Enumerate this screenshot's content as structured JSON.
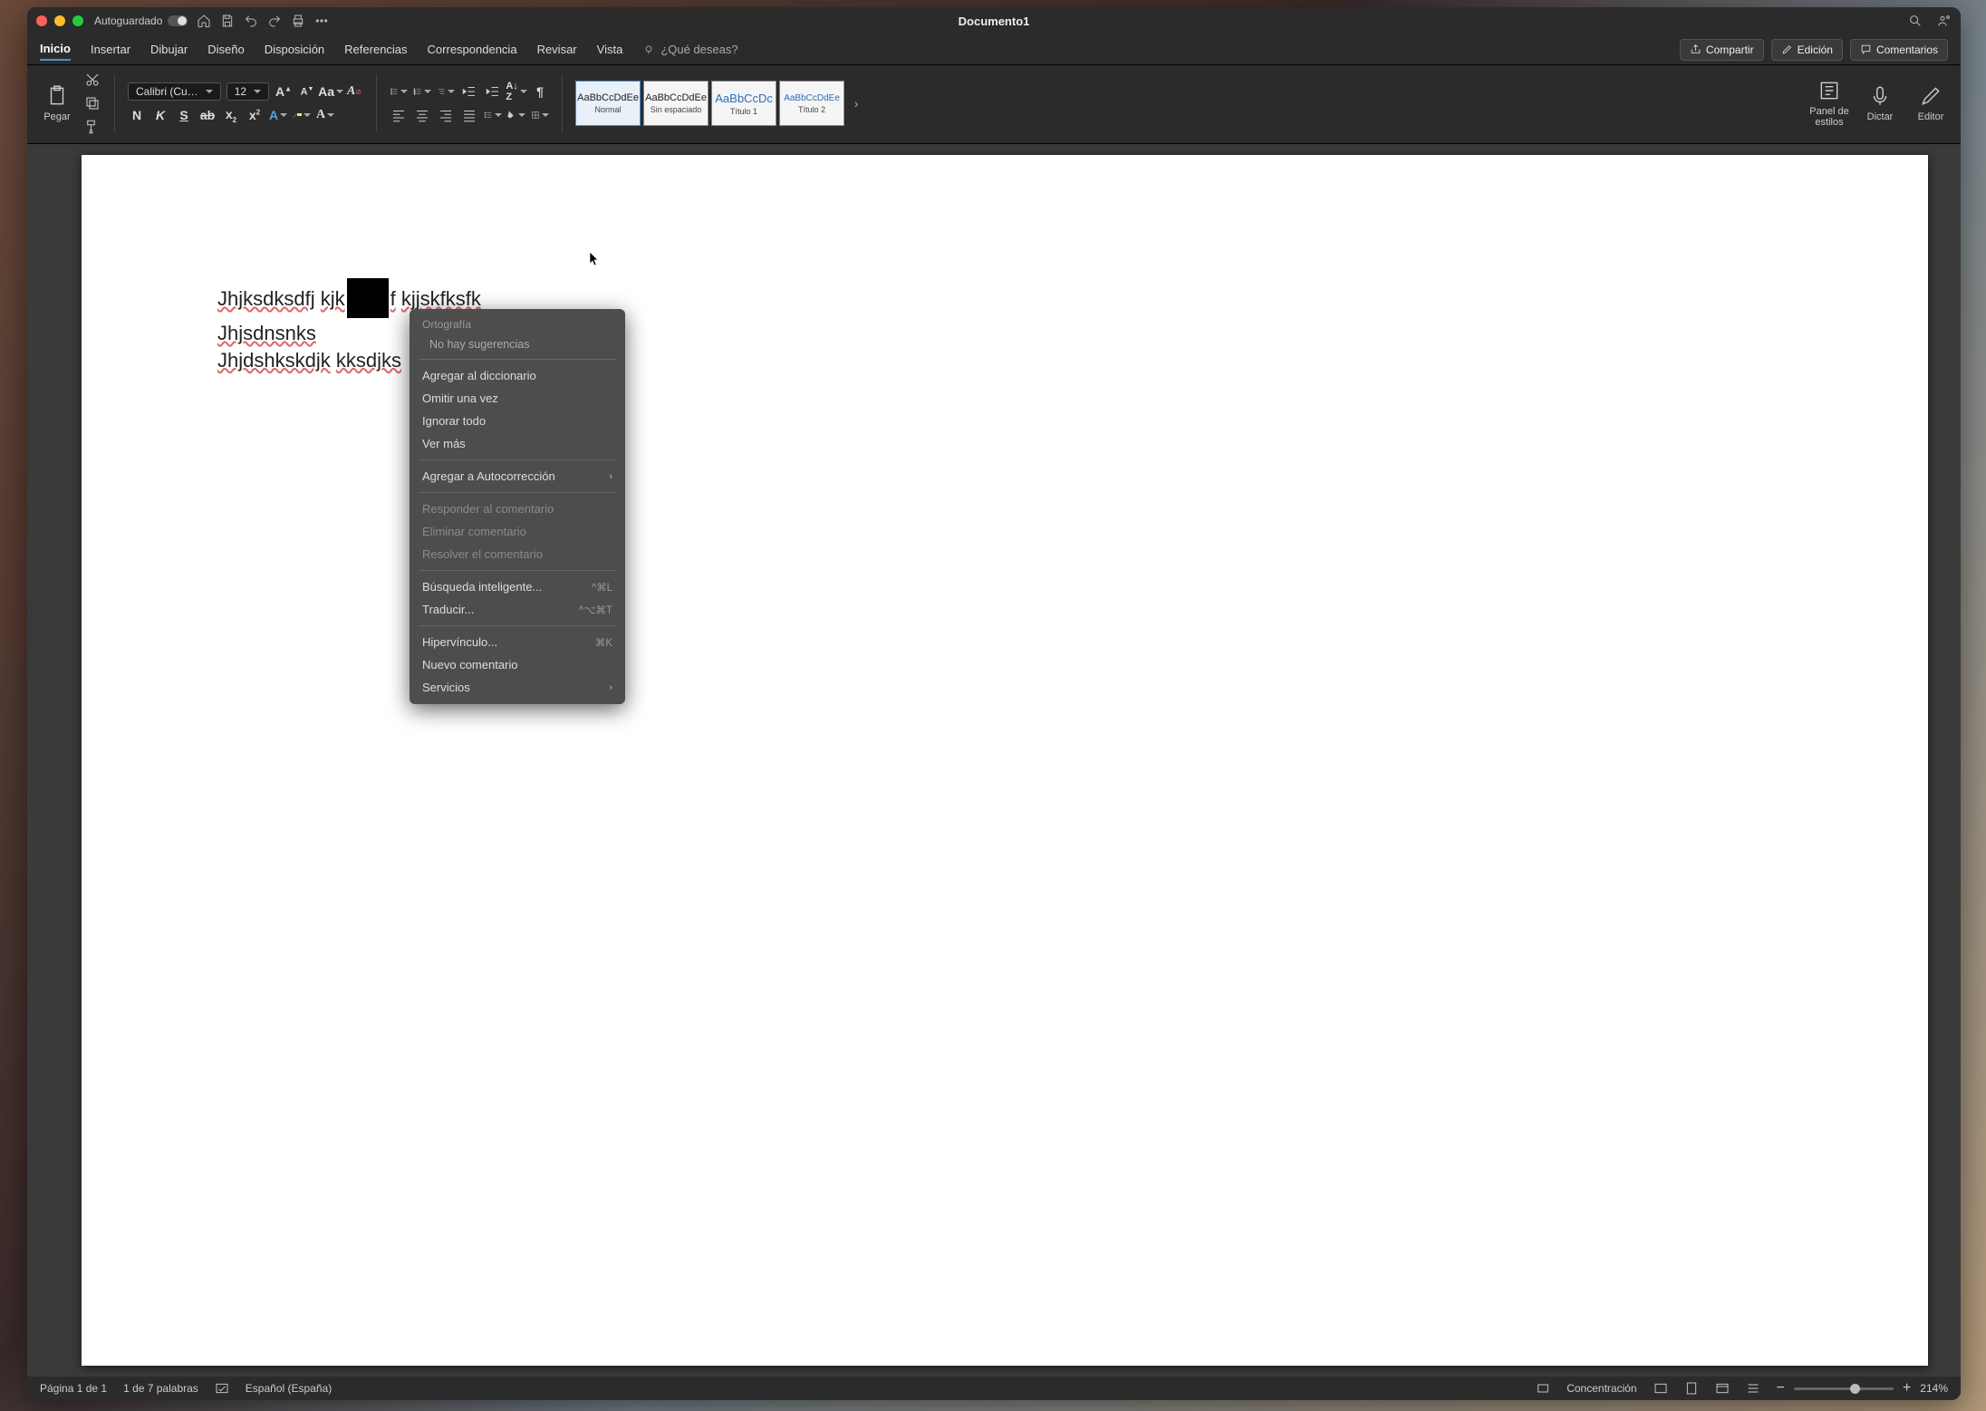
{
  "titlebar": {
    "autosave_label": "Autoguardado",
    "title": "Documento1"
  },
  "tabs": {
    "inicio": "Inicio",
    "insertar": "Insertar",
    "dibujar": "Dibujar",
    "diseno": "Diseño",
    "disposicion": "Disposición",
    "referencias": "Referencias",
    "correspondencia": "Correspondencia",
    "revisar": "Revisar",
    "vista": "Vista",
    "tellme": "¿Qué deseas?"
  },
  "header_buttons": {
    "compartir": "Compartir",
    "edicion": "Edición",
    "comentarios": "Comentarios"
  },
  "ribbon": {
    "paste_label": "Pegar",
    "font_name": "Calibri (Cu…",
    "font_size": "12",
    "styles": {
      "sample": "AaBbCcDdEe",
      "sample_t1": "AaBbCcDc",
      "sample_t2": "AaBbCcDdEe",
      "normal": "Normal",
      "sin_espaciado": "Sin espaciado",
      "titulo1": "Título 1",
      "titulo2": "Título 2"
    },
    "panel_estilos": "Panel de\nestilos",
    "dictar": "Dictar",
    "editor": "Editor"
  },
  "document": {
    "line1a": "Jhjksdksdfj",
    "line1b": "kjk",
    "line1c": "f",
    "line1d": "kjjskfksfk",
    "line2": "Jhjsdnsnks",
    "line3a": "Jhjdshkskdjk",
    "line3b": "kksdjks"
  },
  "context_menu": {
    "ortografia": "Ortografía",
    "no_sugerencias": "No hay sugerencias",
    "agregar_dicc": "Agregar al diccionario",
    "omitir": "Omitir una vez",
    "ignorar": "Ignorar todo",
    "ver_mas": "Ver más",
    "agregar_autocorr": "Agregar a Autocorrección",
    "responder": "Responder al comentario",
    "eliminar": "Eliminar comentario",
    "resolver": "Resolver el comentario",
    "busqueda": "Búsqueda inteligente...",
    "busqueda_sc": "^⌘L",
    "traducir": "Traducir...",
    "traducir_sc": "^⌥⌘T",
    "hipervinculo": "Hipervínculo...",
    "hipervinculo_sc": "⌘K",
    "nuevo_comentario": "Nuevo comentario",
    "servicios": "Servicios"
  },
  "status": {
    "page": "Página 1 de 1",
    "words": "1 de 7 palabras",
    "lang": "Español (España)",
    "concentracion": "Concentración",
    "zoom": "214%"
  }
}
